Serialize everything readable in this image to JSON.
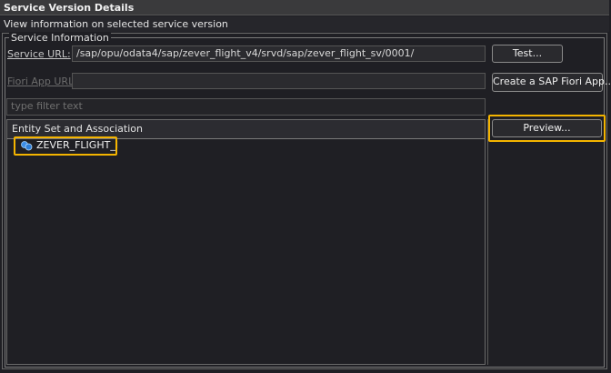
{
  "window": {
    "title": "Service Version Details",
    "description": "View information on selected service version"
  },
  "service_info": {
    "group_label": "Service Information",
    "service_url_label": "Service URL:",
    "service_url_value": "/sap/opu/odata4/sap/zever_flight_v4/srvd/sap/zever_flight_sv/0001/",
    "fiori_app_url_label": "Fiori App URL:",
    "fiori_app_url_value": "",
    "test_button": "Test...",
    "create_fiori_button": "Create a SAP Fiori App..."
  },
  "filter": {
    "placeholder": "type filter text"
  },
  "entity_tree": {
    "header": "Entity Set and Association",
    "items": [
      {
        "label": "ZEVER_FLIGHT_I",
        "icon": "entity-set-icon"
      }
    ]
  },
  "actions": {
    "preview_button": "Preview..."
  },
  "colors": {
    "highlight": "#f4b400",
    "background": "#1f1f24"
  }
}
